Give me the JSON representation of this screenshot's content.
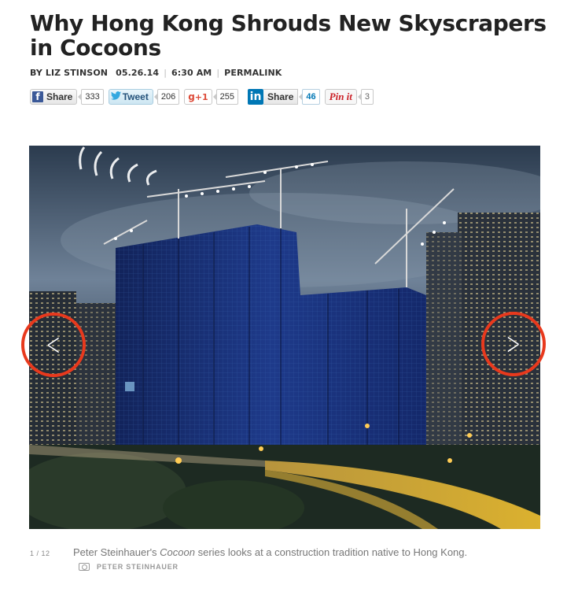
{
  "article": {
    "title": "Why Hong Kong Shrouds New Skyscrapers in Cocoons",
    "byline": {
      "author": "BY LIZ STINSON",
      "date": "05.26.14",
      "time": "6:30 AM",
      "permalink": "PERMALINK"
    }
  },
  "share": {
    "facebook": {
      "icon": "facebook-icon",
      "label": "Share",
      "count": "333"
    },
    "twitter": {
      "icon": "twitter-bird-icon",
      "label": "Tweet",
      "count": "206"
    },
    "googleplus": {
      "label": "g",
      "plus": "+1",
      "count": "255"
    },
    "linkedin": {
      "icon": "linkedin-icon",
      "icon_text": "in",
      "label": "Share",
      "count": "46"
    },
    "pinterest": {
      "label": "Pin it",
      "count": "3"
    }
  },
  "gallery": {
    "prev_icon": "chevron-left-icon",
    "next_icon": "chevron-right-icon",
    "prev_glyph": "<",
    "next_glyph": ">",
    "highlight_color": "#e8391d",
    "counter": "1 / 12",
    "caption_prefix": "Peter Steinhauer's ",
    "caption_italic": "Cocoon",
    "caption_suffix": " series looks at a construction tradition native to Hong Kong.",
    "credit_icon": "camera-icon",
    "credit": "PETER STEINHAUER"
  }
}
